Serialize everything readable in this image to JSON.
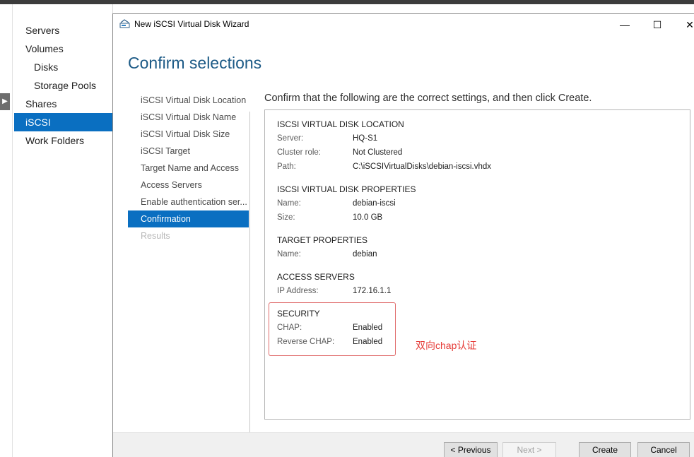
{
  "nav": {
    "items": [
      {
        "label": "Servers",
        "sub": false,
        "active": false
      },
      {
        "label": "Volumes",
        "sub": false,
        "active": false
      },
      {
        "label": "Disks",
        "sub": true,
        "active": false
      },
      {
        "label": "Storage Pools",
        "sub": true,
        "active": false
      },
      {
        "label": "Shares",
        "sub": false,
        "active": false
      },
      {
        "label": "iSCSI",
        "sub": false,
        "active": true
      },
      {
        "label": "Work Folders",
        "sub": false,
        "active": false
      }
    ]
  },
  "dialog": {
    "title": "New iSCSI Virtual Disk Wizard",
    "heading": "Confirm selections",
    "steps": [
      {
        "label": "iSCSI Virtual Disk Location",
        "state": "normal"
      },
      {
        "label": "iSCSI Virtual Disk Name",
        "state": "normal"
      },
      {
        "label": "iSCSI Virtual Disk Size",
        "state": "normal"
      },
      {
        "label": "iSCSI Target",
        "state": "normal"
      },
      {
        "label": "Target Name and Access",
        "state": "normal"
      },
      {
        "label": "Access Servers",
        "state": "normal"
      },
      {
        "label": "Enable authentication ser...",
        "state": "normal"
      },
      {
        "label": "Confirmation",
        "state": "active"
      },
      {
        "label": "Results",
        "state": "disabled"
      }
    ],
    "confirm_text": "Confirm that the following are the correct settings, and then click Create.",
    "sections": {
      "location": {
        "title": "ISCSI VIRTUAL DISK LOCATION",
        "rows": [
          {
            "k": "Server:",
            "v": "HQ-S1"
          },
          {
            "k": "Cluster role:",
            "v": "Not Clustered"
          },
          {
            "k": "Path:",
            "v": "C:\\iSCSIVirtualDisks\\debian-iscsi.vhdx"
          }
        ]
      },
      "properties": {
        "title": "ISCSI VIRTUAL DISK PROPERTIES",
        "rows": [
          {
            "k": "Name:",
            "v": "debian-iscsi"
          },
          {
            "k": "Size:",
            "v": "10.0 GB"
          }
        ]
      },
      "target": {
        "title": "TARGET PROPERTIES",
        "rows": [
          {
            "k": "Name:",
            "v": "debian"
          }
        ]
      },
      "access": {
        "title": "ACCESS SERVERS",
        "rows": [
          {
            "k": "IP Address:",
            "v": "172.16.1.1"
          }
        ]
      },
      "security": {
        "title": "SECURITY",
        "rows": [
          {
            "k": "CHAP:",
            "v": "Enabled"
          },
          {
            "k": "Reverse CHAP:",
            "v": "Enabled"
          }
        ]
      }
    },
    "annotation": "双向chap认证",
    "buttons": {
      "previous": "< Previous",
      "next": "Next >",
      "create": "Create",
      "cancel": "Cancel"
    },
    "window_controls": {
      "minimize": "—",
      "maximize": "☐",
      "close": "✕"
    }
  },
  "colors": {
    "accent": "#0a6fc1",
    "heading": "#1c5a86",
    "annotation": "#e53935"
  }
}
